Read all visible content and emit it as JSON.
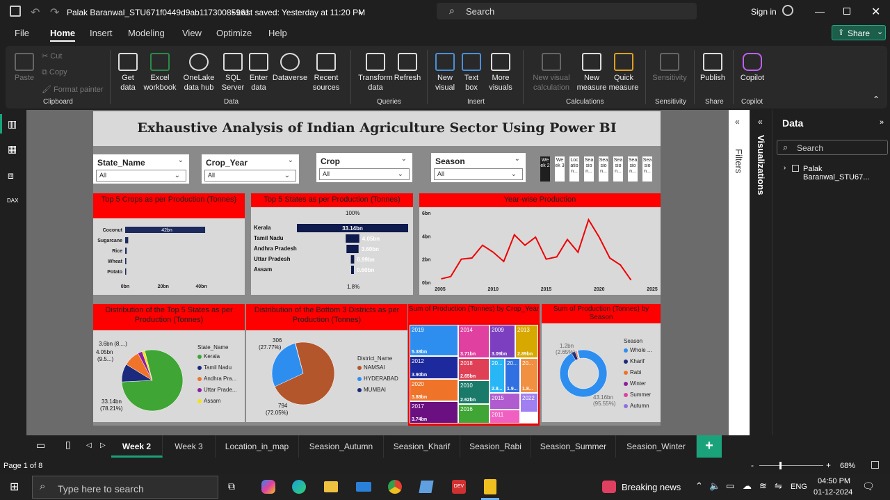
{
  "titlebar": {
    "file_name": "Palak Baranwal_STU671f0449d9ab11730085961",
    "saved": " • Last saved: Yesterday at 11:20 PM",
    "search": "Search",
    "signin": "Sign in"
  },
  "menu": [
    "File",
    "Home",
    "Insert",
    "Modeling",
    "View",
    "Optimize",
    "Help"
  ],
  "share": "Share",
  "ribbon": {
    "clipboard": {
      "paste": "Paste",
      "cut": "Cut",
      "copy": "Copy",
      "format": "Format painter",
      "group": "Clipboard"
    },
    "data": {
      "get": "Get\ndata",
      "excel": "Excel\nworkbook",
      "onelake": "OneLake\ndata hub",
      "sql": "SQL\nServer",
      "enter": "Enter\ndata",
      "dataverse": "Dataverse",
      "recent": "Recent\nsources",
      "group": "Data"
    },
    "queries": {
      "transform": "Transform\ndata",
      "refresh": "Refresh",
      "group": "Queries"
    },
    "insert": {
      "newvisual": "New\nvisual",
      "textbox": "Text\nbox",
      "more": "More\nvisuals",
      "group": "Insert"
    },
    "calc": {
      "newcalc": "New visual\ncalculation",
      "newmeasure": "New\nmeasure",
      "quick": "Quick\nmeasure",
      "group": "Calculations"
    },
    "sens": {
      "label": "Sensitivity",
      "group": "Sensitivity"
    },
    "share": {
      "publish": "Publish",
      "group": "Share"
    },
    "copilot": {
      "label": "Copilot",
      "group": "Copilot"
    }
  },
  "report": {
    "title": "Exhaustive Analysis of Indian Agriculture Sector Using Power BI",
    "slicers": [
      {
        "title": "State_Name",
        "value": "All"
      },
      {
        "title": "Crop_Year",
        "value": "All"
      },
      {
        "title": "Crop",
        "value": "All"
      },
      {
        "title": "Season",
        "value": "All"
      }
    ],
    "week_buttons": [
      "We ek 2",
      "We ek 3",
      "Loc atio n...",
      "Sea sio n...",
      "Sea sio n...",
      "Sea sio n...",
      "Sea sio n...",
      "Sea sio n..."
    ],
    "crops": {
      "title": "Top 5 Crops as per Production (Tonnes)",
      "labels": [
        "Coconut",
        "Sugarcane",
        "Rice",
        "Wheat",
        "Potato"
      ],
      "values": [
        42,
        1.6,
        0.8,
        0.6,
        0.3
      ],
      "data_label": "42bn",
      "ticks": [
        "0bn",
        "20bn",
        "40bn"
      ]
    },
    "states": {
      "title": "Top 5 States as per Production (Tonnes)",
      "top": "100%",
      "bottom": "1.8%",
      "labels": [
        "Kerala",
        "Tamil Nadu",
        "Andhra Pradesh",
        "Uttar Pradesh",
        "Assam"
      ],
      "values": [
        33.14,
        4.05,
        3.6,
        0.99,
        0.6
      ],
      "value_labels": [
        "33.14bn",
        "4.05bn",
        "3.60bn",
        "0.99bn",
        "0.60bn"
      ]
    },
    "yearwise": {
      "title": "Year-wise Production",
      "yticks": [
        "6bn",
        "4bn",
        "2bn",
        "0bn"
      ],
      "xticks": [
        "2005",
        "2010",
        "2015",
        "2020",
        "2025"
      ],
      "x": [
        2006,
        2007,
        2008,
        2009,
        2010,
        2011,
        2012,
        2013,
        2014,
        2015,
        2016,
        2017,
        2018,
        2019,
        2020,
        2021,
        2022,
        2023
      ],
      "y": [
        0.3,
        0.5,
        2.0,
        2.1,
        3.2,
        2.6,
        1.8,
        4.1,
        3.2,
        3.9,
        2.0,
        2.2,
        3.7,
        2.6,
        5.4,
        3.9,
        2.1,
        1.5,
        0.2
      ]
    },
    "pie_states": {
      "title": "Distribution of the Top 5 States as per Production (Tonnes)",
      "legend_title": "State_Name",
      "legend": [
        "Kerala",
        "Tamil Nadu",
        "Andhra Pra...",
        "Uttar Prade...",
        "Assam"
      ],
      "colors": [
        "#3fa535",
        "#1c2a7d",
        "#f0732a",
        "#8e1f9e",
        "#f3e215"
      ],
      "values": [
        33.14,
        4.05,
        3.6,
        0.99,
        0.6
      ],
      "lbl1": "3.6bn (8....)",
      "lbl2": "4.05bn",
      "lbl2b": "(9.5...)",
      "lbl3": "33.14bn",
      "lbl3b": "(78.21%)"
    },
    "pie_districts": {
      "title": "Distribution of the Bottom 3 Districts as per Production (Tonnes)",
      "legend_title": "District_Name",
      "legend": [
        "NAMSAI",
        "HYDERABAD",
        "MUMBAI"
      ],
      "colors": [
        "#b3562b",
        "#2d8ef0",
        "#1c2a7d"
      ],
      "values": [
        794,
        306,
        2
      ],
      "lbl1": "306",
      "lbl1b": "(27.77%)",
      "lbl2": "794",
      "lbl2b": "(72.05%)"
    },
    "treemap": {
      "title": "Sum of Production (Tonnes) by Crop_Year",
      "cells": [
        {
          "y": "2019",
          "v": "5.38bn",
          "c": "#2d8ef0"
        },
        {
          "y": "2014",
          "v": "3.71bn",
          "c": "#e0409f"
        },
        {
          "y": "2009",
          "v": "3.09bn",
          "c": "#7b3fc0"
        },
        {
          "y": "2013",
          "v": "2.89bn",
          "c": "#d6a800"
        },
        {
          "y": "2012",
          "v": "3.90bn",
          "c": "#1c2a9d"
        },
        {
          "y": "2018",
          "v": "2.65bn",
          "c": "#e04055"
        },
        {
          "y": "20...",
          "v": "2.8...",
          "c": "#29b6f6"
        },
        {
          "y": "20...",
          "v": "1.9...",
          "c": "#3070e0"
        },
        {
          "y": "20...",
          "v": "1.8...",
          "c": "#f09040"
        },
        {
          "y": "2020",
          "v": "3.88bn",
          "c": "#f0732a"
        },
        {
          "y": "2010",
          "v": "2.62bn",
          "c": "#1a7a6a"
        },
        {
          "y": "2015",
          "v": "",
          "c": "#b05cd0"
        },
        {
          "y": "2022",
          "v": "",
          "c": "#a080f0"
        },
        {
          "y": "2017",
          "v": "3.74bn",
          "c": "#6a1080"
        },
        {
          "y": "2016",
          "v": "",
          "c": "#3fa535"
        },
        {
          "y": "2011",
          "v": "",
          "c": "#f060c0"
        }
      ]
    },
    "donut": {
      "title": "Sum of Production (Tonnes) by Season",
      "legend_title": "Season",
      "legend": [
        "Whole ...",
        "Kharif",
        "Rabi",
        "Winter",
        "Summer",
        "Autumn"
      ],
      "colors": [
        "#2d8ef0",
        "#1c2a7d",
        "#f0732a",
        "#8e1f9e",
        "#e0409f",
        "#9070e0"
      ],
      "values": [
        95.55,
        2.65,
        1.0,
        0.4,
        0.3,
        0.1
      ],
      "lbl1": "1.2bn",
      "lbl1b": "(2.65%)",
      "lbl2": "43.16bn",
      "lbl2b": "(95.55%)"
    }
  },
  "filters": "Filters",
  "visualizations": "Visualizations",
  "datapane": {
    "title": "Data",
    "search": "Search",
    "item": "Palak Baranwal_STU67..."
  },
  "tabs": [
    "Week 2",
    "Week 3",
    "Location_in_map",
    "Seasion_Autumn",
    "Seasion_Kharif",
    "Seasion_Rabi",
    "Seasion_Summer",
    "Seasion_Winter"
  ],
  "status": {
    "page": "Page 1 of 8",
    "zoom": "68%"
  },
  "taskbar": {
    "search": "Type here to search",
    "news": "Breaking news",
    "lang": "ENG",
    "time": "04:50 PM",
    "date": "01-12-2024"
  }
}
